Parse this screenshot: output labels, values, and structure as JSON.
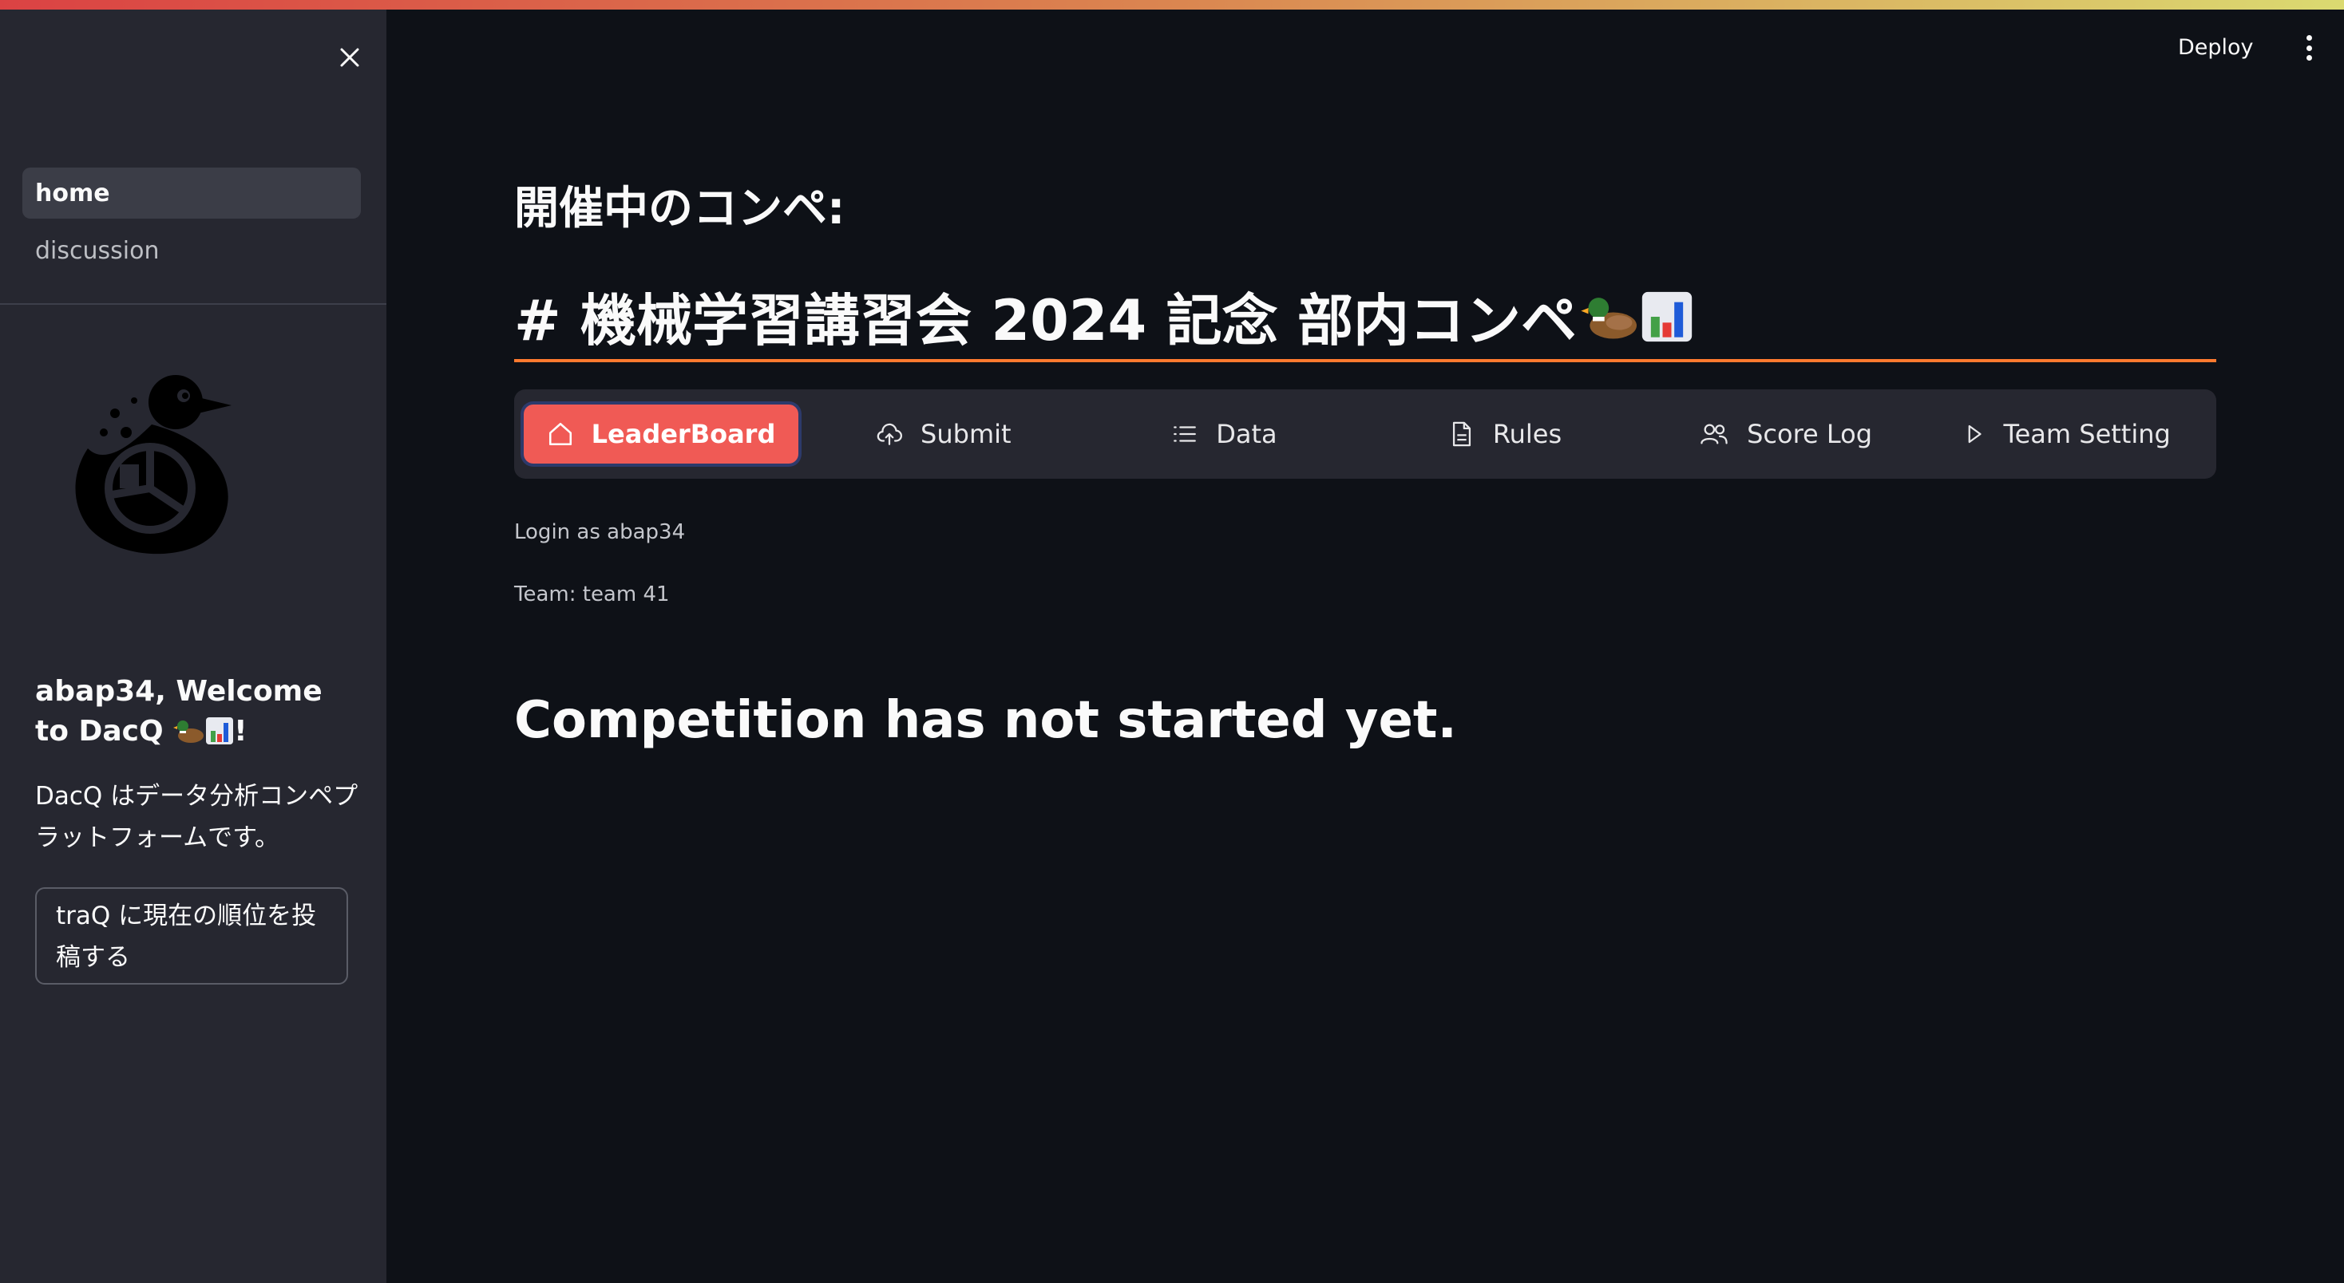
{
  "colors": {
    "background": "#0e1117",
    "sidebar": "#262730",
    "accent": "#f05a55",
    "title_rule": "#ff7a2f"
  },
  "sidebar": {
    "close_icon": "close-icon",
    "nav": [
      {
        "label": "home",
        "active": true
      },
      {
        "label": "discussion",
        "active": false
      }
    ],
    "welcome": "abap34, Welcome to DacQ",
    "welcome_suffix": "!",
    "description": "DacQ はデータ分析コンペプラットフォームです。",
    "traq_button": "traQ に現在の順位を投稿する"
  },
  "header": {
    "deploy_label": "Deploy",
    "menu_icon": "more-vertical-icon"
  },
  "main": {
    "subtitle": "開催中のコンペ:",
    "title": "# 機械学習講習会 2024 記念 部内コンペ",
    "tabs": [
      {
        "label": "LeaderBoard",
        "icon": "home-icon",
        "active": true
      },
      {
        "label": "Submit",
        "icon": "cloud-upload-icon",
        "active": false
      },
      {
        "label": "Data",
        "icon": "list-icon",
        "active": false
      },
      {
        "label": "Rules",
        "icon": "document-icon",
        "active": false
      },
      {
        "label": "Score Log",
        "icon": "people-icon",
        "active": false
      },
      {
        "label": "Team Setting",
        "icon": "play-icon",
        "active": false
      }
    ],
    "login_text": "Login as abap34",
    "team_text": "Team: team 41",
    "status_message": "Competition has not started yet."
  }
}
